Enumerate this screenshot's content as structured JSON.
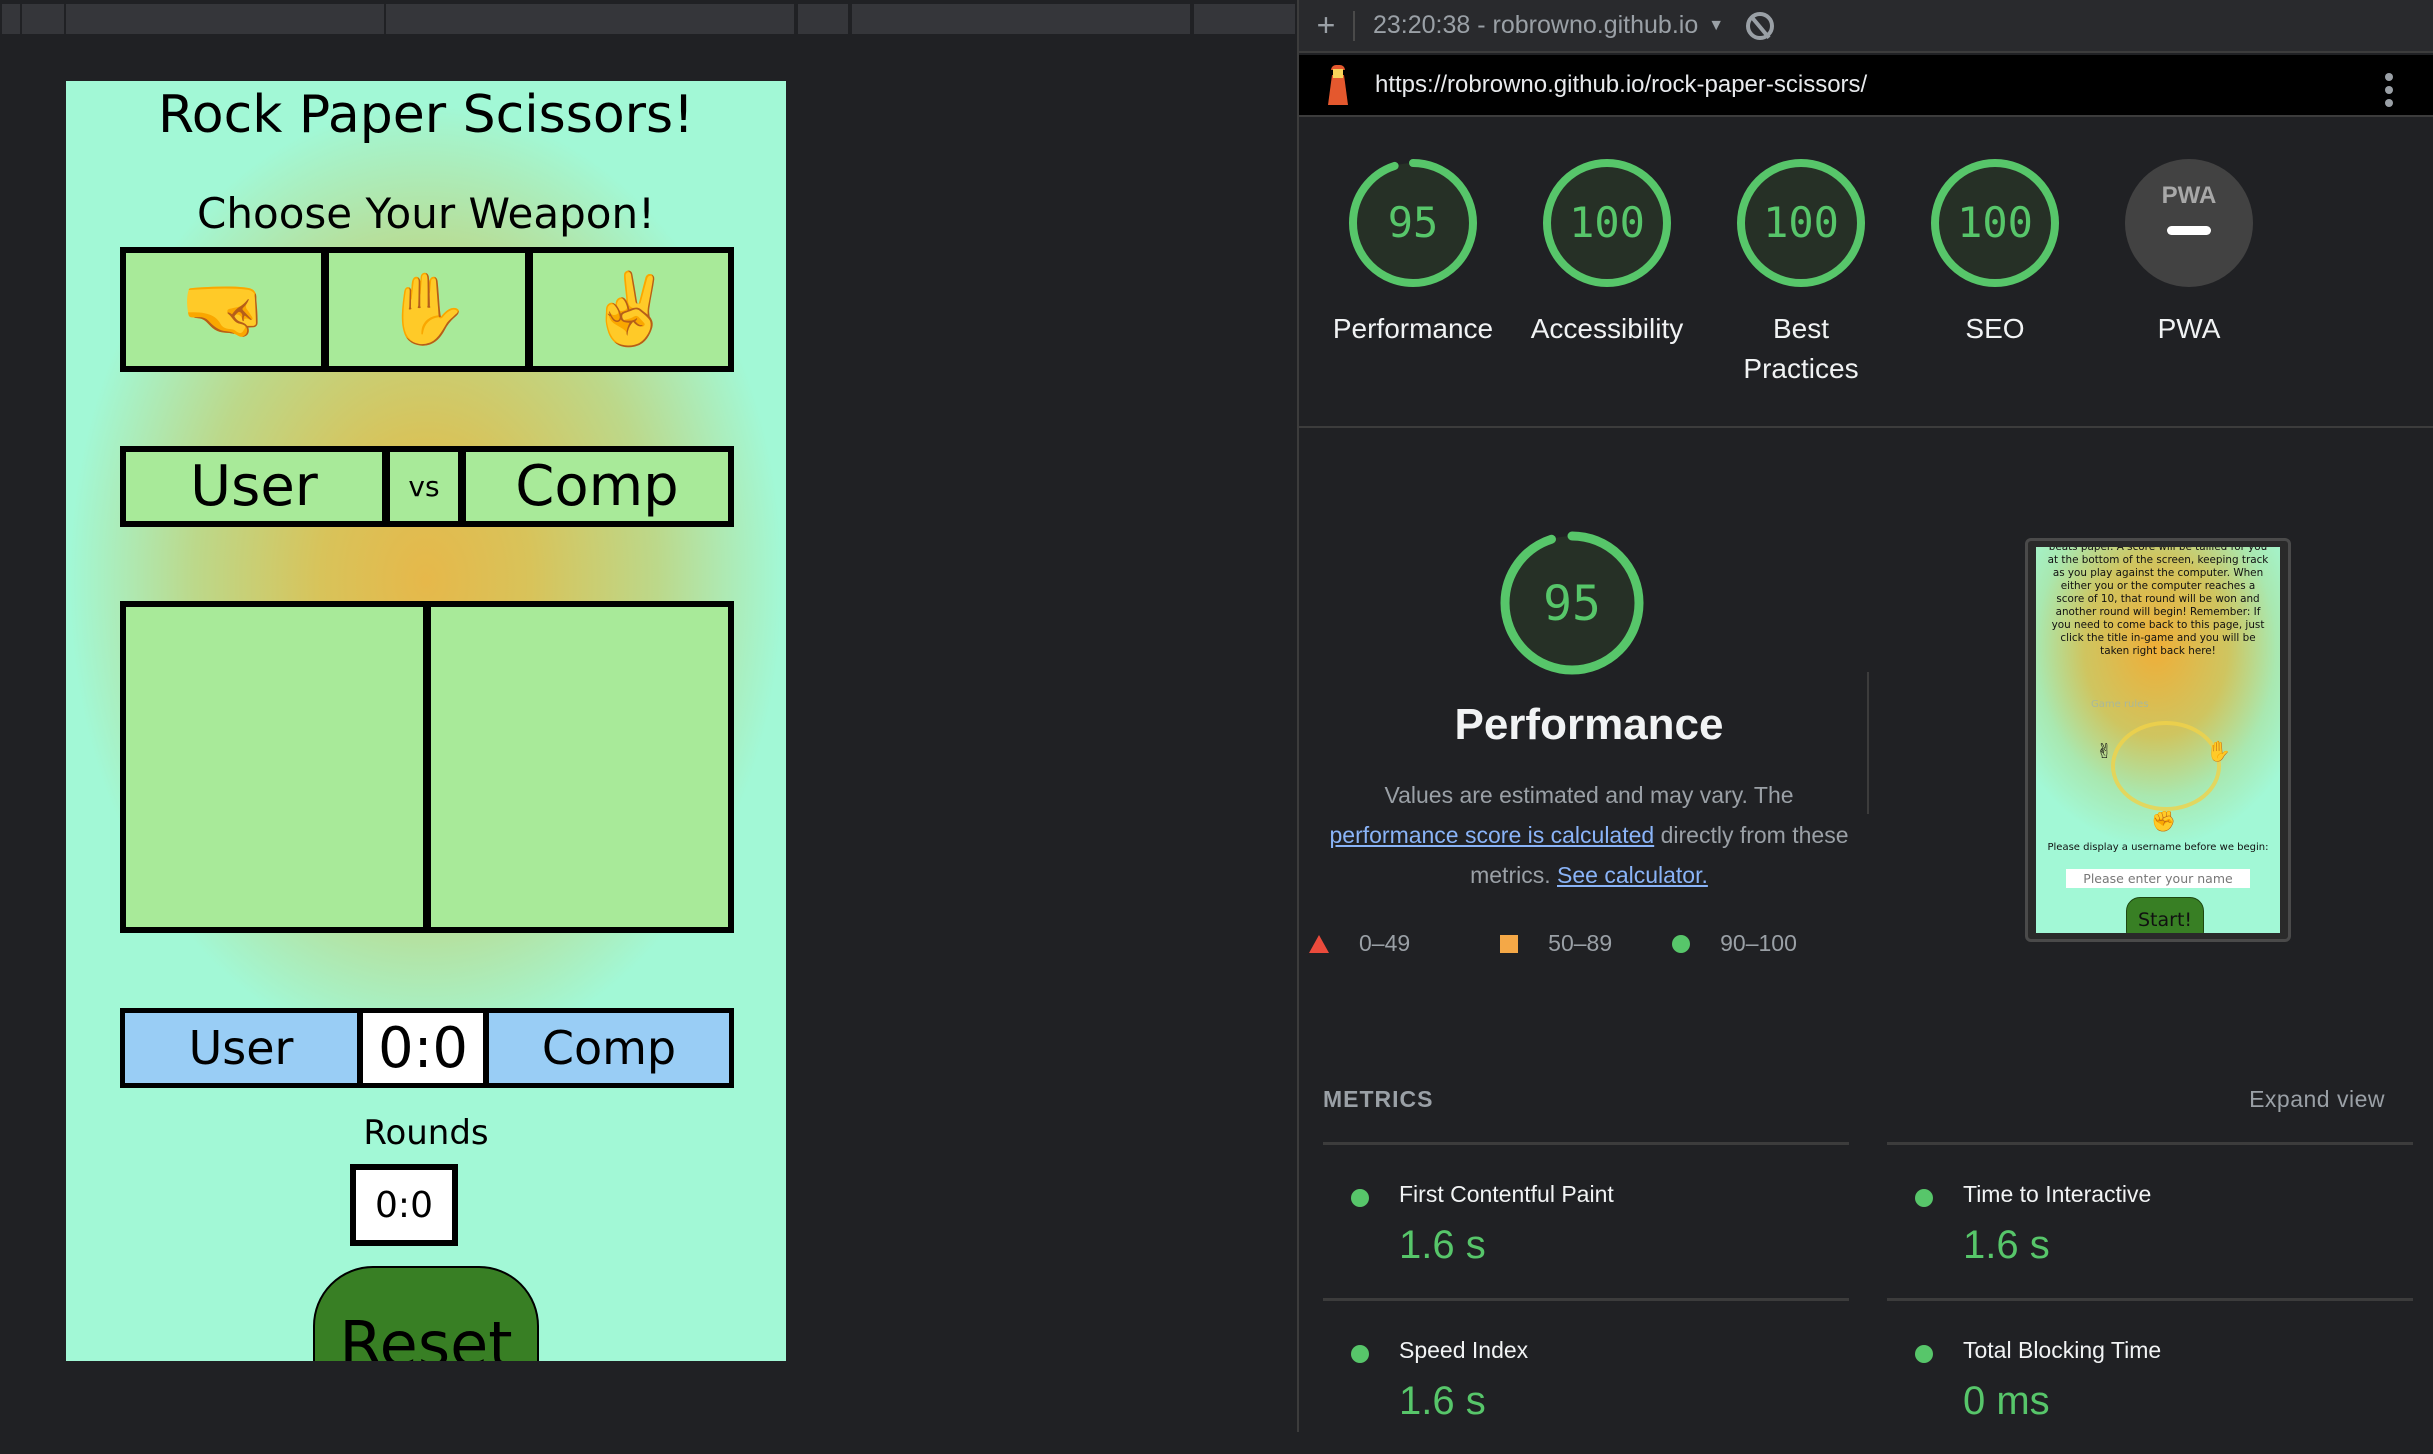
{
  "devtools": {
    "new_report_label": "+",
    "report_selector": "23:20:38 - robrowno.github.io",
    "url": "https://robrowno.github.io/rock-paper-scissors/"
  },
  "game": {
    "title": "Rock Paper Scissors!",
    "subtitle": "Choose Your Weapon!",
    "weapons": [
      {
        "name": "rock",
        "glyph": "🤜"
      },
      {
        "name": "paper",
        "glyph": "✋"
      },
      {
        "name": "scissors",
        "glyph": "✌️"
      }
    ],
    "vs": {
      "user": "User",
      "vs": "vs",
      "comp": "Comp"
    },
    "score": {
      "user": "User",
      "value": "0:0",
      "comp": "Comp"
    },
    "rounds": {
      "label": "Rounds",
      "value": "0:0"
    },
    "reset_label": "Reset"
  },
  "lighthouse": {
    "categories": [
      {
        "label": "Performance",
        "score": 95,
        "color": "#57c66a"
      },
      {
        "label": "Accessibility",
        "score": 100,
        "color": "#57c66a"
      },
      {
        "label": "Best Practices",
        "score": 100,
        "color": "#57c66a"
      },
      {
        "label": "SEO",
        "score": 100,
        "color": "#57c66a"
      },
      {
        "label": "PWA",
        "score": null,
        "badge_text": "PWA"
      }
    ],
    "performance": {
      "score": 95,
      "title": "Performance",
      "desc_prefix": "Values are estimated and may vary. The ",
      "desc_link": "performance score is calculated",
      "desc_mid": " directly from these metrics. ",
      "desc_link2": "See calculator."
    },
    "legend": [
      {
        "range": "0–49",
        "shape": "triangle",
        "color": "#eb4b3c"
      },
      {
        "range": "50–89",
        "shape": "square",
        "color": "#f4a847"
      },
      {
        "range": "90–100",
        "shape": "circle",
        "color": "#57c66a"
      }
    ],
    "screenshot": {
      "text": "beats paper. A score will be tallied for you at the bottom of the screen, keeping track as you play against the computer. When either you or the computer reaches a score of 10, that round will be won and another round will begin! Remember: If you need to come back to this page, just click the title in-game and you will be taken right back here!",
      "rules_title": "Game rules",
      "prompt": "Please display a username before we begin:",
      "input_placeholder": "Please enter your name",
      "start_label": "Start!"
    },
    "metrics_heading": "METRICS",
    "expand_label": "Expand view",
    "metrics": [
      {
        "name": "First Contentful Paint",
        "value": "1.6 s"
      },
      {
        "name": "Time to Interactive",
        "value": "1.6 s"
      },
      {
        "name": "Speed Index",
        "value": "1.6 s"
      },
      {
        "name": "Total Blocking Time",
        "value": "0 ms"
      }
    ]
  }
}
